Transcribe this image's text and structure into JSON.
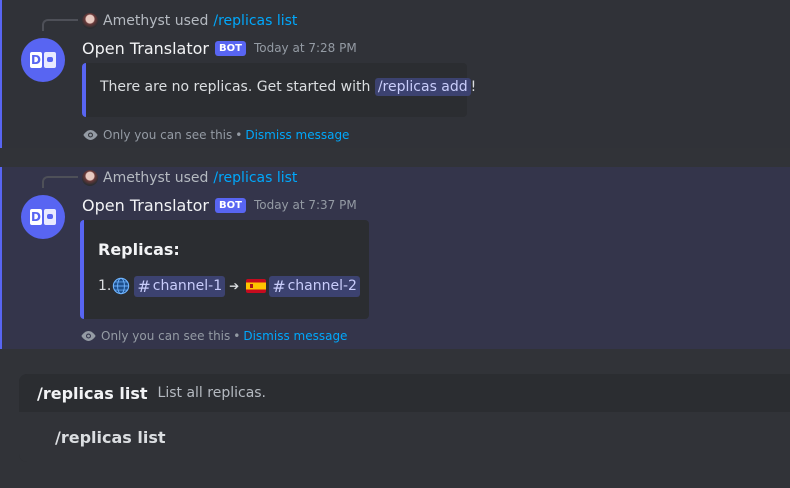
{
  "messages": [
    {
      "reply": {
        "user": "Amethyst",
        "used": "used",
        "command": "/replicas list"
      },
      "author": "Open Translator",
      "badge": "BOT",
      "time": "Today at 7:28 PM",
      "embed": {
        "text_before": "There are no replicas. Get started with ",
        "command": "/replicas add",
        "text_after": "!"
      },
      "ephemeral": {
        "notice": "Only you can see this",
        "separator": "•",
        "dismiss": "Dismiss message"
      }
    },
    {
      "reply": {
        "user": "Amethyst",
        "used": "used",
        "command": "/replicas list"
      },
      "author": "Open Translator",
      "badge": "BOT",
      "time": "Today at 7:37 PM",
      "embed": {
        "title": "Replicas:",
        "item_number": "1.",
        "source_channel": "channel-1",
        "target_channel": "channel-2",
        "hash": "#",
        "arrow": "➔"
      },
      "ephemeral": {
        "notice": "Only you can see this",
        "separator": "•",
        "dismiss": "Dismiss message"
      }
    }
  ],
  "autocomplete": {
    "command": "/replicas list",
    "description": "List all replicas.",
    "input_value": "/replicas list"
  },
  "colors": {
    "accent": "#5865f2",
    "link": "#00a8fc",
    "background": "#313338"
  }
}
